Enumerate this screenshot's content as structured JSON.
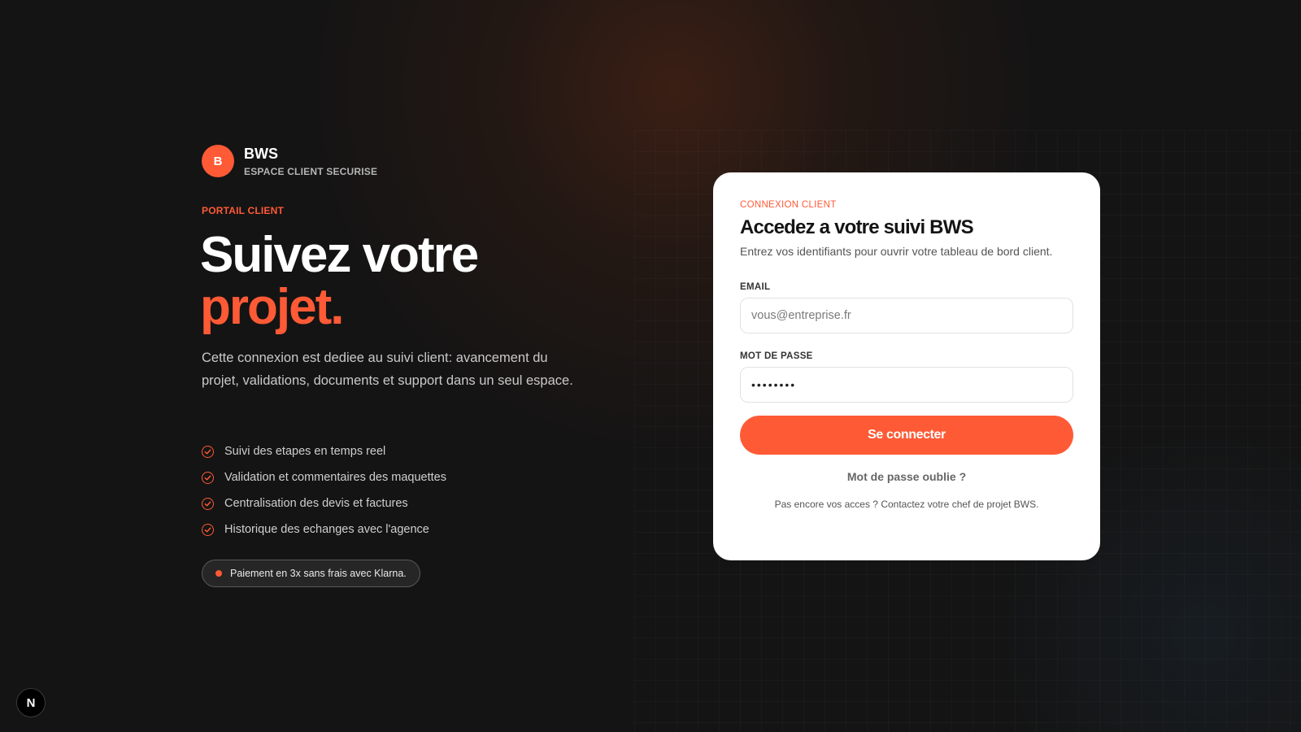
{
  "brand": {
    "logo_letter": "B",
    "name": "BWS",
    "subtitle": "ESPACE CLIENT SECURISE"
  },
  "hero": {
    "eyebrow": "PORTAIL CLIENT",
    "headline_line1": "Suivez votre",
    "headline_line2": "projet.",
    "intro": "Cette connexion est dediee au suivi client: avancement du projet, validations, documents et support dans un seul espace."
  },
  "features": [
    {
      "icon": "check-circle-icon",
      "label": "Suivi des etapes en temps reel"
    },
    {
      "icon": "check-circle-icon",
      "label": "Validation et commentaires des maquettes"
    },
    {
      "icon": "check-circle-icon",
      "label": "Centralisation des devis et factures"
    },
    {
      "icon": "check-circle-icon",
      "label": "Historique des echanges avec l'agence"
    }
  ],
  "promo": {
    "text": "Paiement en 3x sans frais avec Klarna."
  },
  "login": {
    "eyebrow": "CONNEXION CLIENT",
    "title": "Accedez a votre suivi BWS",
    "description": "Entrez vos identifiants pour ouvrir votre tableau de bord client.",
    "email_label": "EMAIL",
    "email_placeholder": "vous@entreprise.fr",
    "email_value": "",
    "password_label": "MOT DE PASSE",
    "password_value": "12345678",
    "submit_label": "Se connecter",
    "forgot_label": "Mot de passe oublie ?",
    "contact_text": "Pas encore vos acces ? Contactez votre chef de projet BWS."
  },
  "dev_badge": {
    "letter": "N",
    "icon": "nextjs-icon"
  },
  "colors": {
    "accent": "#ff5a36",
    "background": "#141414",
    "card": "#ffffff"
  }
}
